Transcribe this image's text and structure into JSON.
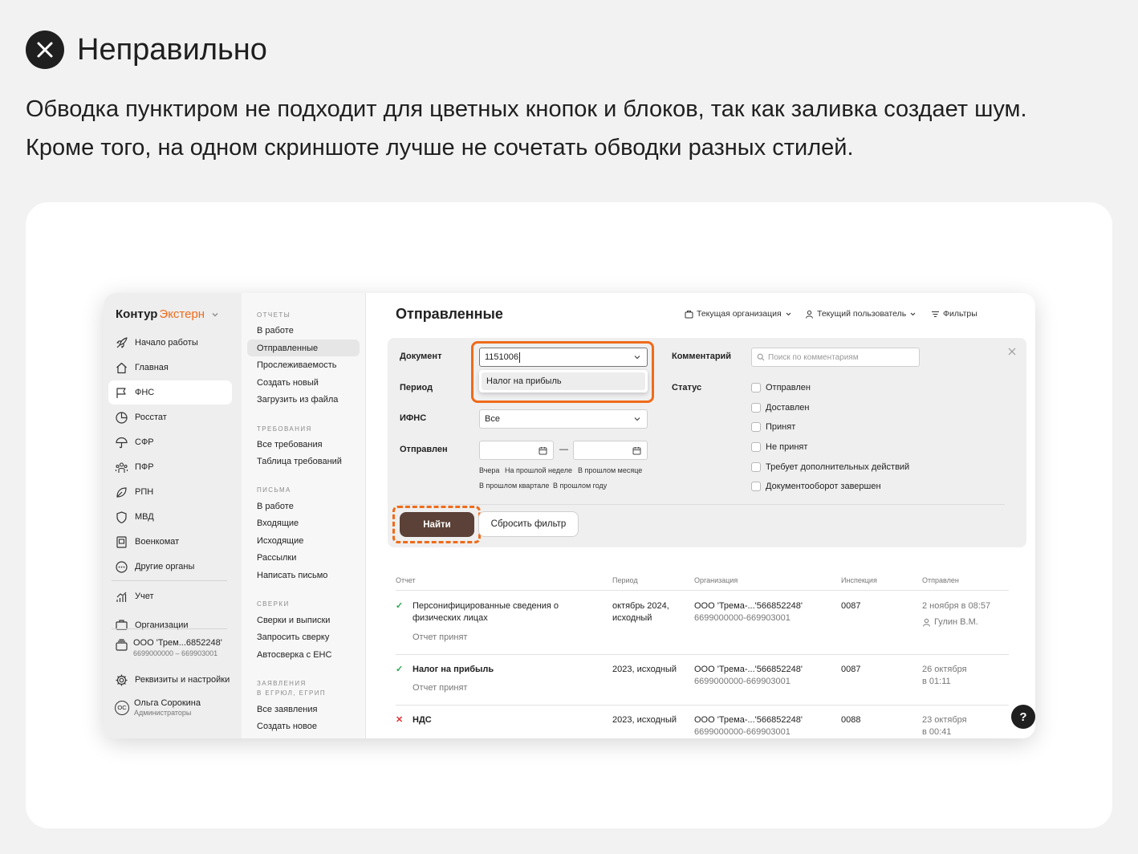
{
  "header": {
    "title": "Неправильно",
    "description": "Обводка пунктиром не подходит для цветных кнопок и блоков, так как заливка создает шум. Кроме того, на одном скриншоте лучше не сочетать обводки разных стилей."
  },
  "colors": {
    "accent": "#ef6b1a",
    "button": "#5b4137",
    "background": "#f2f2f2"
  },
  "app": {
    "logo_part1": "Контур",
    "logo_part2": "Экстерн",
    "sidebar": {
      "items": [
        "Начало работы",
        "Главная",
        "ФНС",
        "Росстат",
        "СФР",
        "ПФР",
        "РПН",
        "МВД",
        "Военкомат",
        "Другие органы",
        "Учет",
        "Организации"
      ],
      "active": "ФНС",
      "org_name": "ООО 'Трем...6852248'",
      "org_code": "6699000000 – 669903001",
      "settings": "Реквизиты и настройки",
      "user_name": "Ольга Сорокина",
      "user_role": "Администраторы",
      "user_initials": "ОС"
    },
    "menu": {
      "reports_title": "ОТЧЕТЫ",
      "reports": [
        "В работе",
        "Отправленные",
        "Прослеживаемость",
        "Создать новый",
        "Загрузить из файла"
      ],
      "req_title": "ТРЕБОВАНИЯ",
      "req": [
        "Все требования",
        "Таблица требований"
      ],
      "letters_title": "ПИСЬМА",
      "letters": [
        "В работе",
        "Входящие",
        "Исходящие",
        "Рассылки",
        "Написать письмо"
      ],
      "recon_title": "СВЕРКИ",
      "recon": [
        "Сверки и выписки",
        "Запросить сверку",
        "Автосверка с ЕНС"
      ],
      "apps_title1": "ЗАЯВЛЕНИЯ",
      "apps_title2": "В ЕГРЮЛ, ЕГРИП",
      "apps": [
        "Все заявления",
        "Создать новое"
      ]
    },
    "page_title": "Отправленные",
    "toolbar": {
      "org": "Текущая организация",
      "user": "Текущий пользователь",
      "filters": "Фильтры"
    },
    "filter": {
      "doc_label": "Документ",
      "doc_value": "1151006",
      "suggestion": "Налог на прибыль",
      "period_label": "Период",
      "ifns_label": "ИФНС",
      "ifns_value": "Все",
      "sent_label": "Отправлен",
      "dash": "—",
      "quick": [
        "Вчера",
        "На прошлой неделе",
        "В прошлом месяце",
        "В прошлом квартале",
        "В прошлом году"
      ],
      "comment_label": "Комментарий",
      "comment_placeholder": "Поиск по комментариям",
      "status_label": "Статус",
      "statuses": [
        "Отправлен",
        "Доставлен",
        "Принят",
        "Не принят",
        "Требует дополнительных действий",
        "Документооборот завершен"
      ],
      "find": "Найти",
      "reset": "Сбросить фильтр"
    },
    "table": {
      "headers": [
        "Отчет",
        "Период",
        "Организация",
        "Инспекция",
        "Отправлен"
      ],
      "rows": [
        {
          "mark": "✓",
          "name1": "Персонифицированные сведения о",
          "name2": "физических лицах",
          "status": "Отчет принят",
          "period1": "октябрь 2024,",
          "period2": "исходный",
          "org1": "ООО 'Трема-...'566852248'",
          "org2": "6699000000-669903001",
          "insp": "0087",
          "sent1": "2 ноября в 08:57",
          "sent2": "Гулин В.М."
        },
        {
          "mark": "✓",
          "name1": "Налог на прибыль",
          "status": "Отчет принят",
          "period1": "2023, исходный",
          "org1": "ООО 'Трема-...'566852248'",
          "org2": "6699000000-669903001",
          "insp": "0087",
          "sent1": "26 октября",
          "sent2": "в 01:11"
        },
        {
          "mark": "✕",
          "name1": "НДС",
          "period1": "2023, исходный",
          "org1": "ООО 'Трема-...'566852248'",
          "org2": "6699000000-669903001",
          "insp": "0088",
          "sent1": "23 октября",
          "sent2": "в 00:41"
        }
      ]
    },
    "help": "?"
  }
}
